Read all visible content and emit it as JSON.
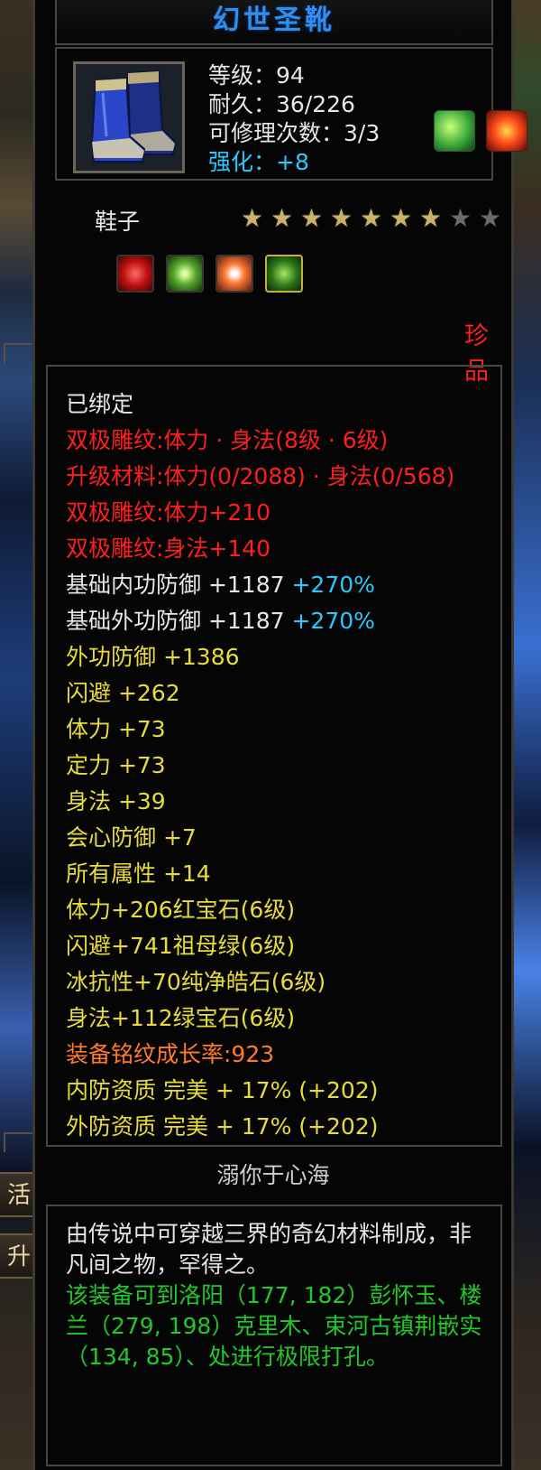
{
  "item": {
    "name": "幻世圣靴",
    "level_label": "等级：94",
    "durability_label": "耐久：36/226",
    "repair_label": "可修理次数：3/3",
    "enhance_prefix": "强化：",
    "enhance_value": "+8",
    "type": "鞋子",
    "rarity": "珍品",
    "stars": {
      "filled": 7,
      "total": 9
    },
    "gems": [
      "red-ruby-gem",
      "green-jade-gem",
      "white-diamond-gem",
      "emerald-gem"
    ],
    "skill_icons": [
      "green-leaf-skill-icon",
      "fire-skill-icon"
    ]
  },
  "attributes": [
    {
      "text": "已绑定",
      "color": "white"
    },
    {
      "text": "双极雕纹:体力 · 身法(8级 · 6级)",
      "color": "red"
    },
    {
      "text": "升级材料:体力(0/2088) · 身法(0/568)",
      "color": "red"
    },
    {
      "text": "双极雕纹:体力+210",
      "color": "red"
    },
    {
      "text": "双极雕纹:身法+140",
      "color": "red"
    },
    {
      "text": "基础内功防御 +1187",
      "color": "white",
      "extra": " +270%"
    },
    {
      "text": "基础外功防御 +1187",
      "color": "white",
      "extra": " +270%"
    },
    {
      "text": "外功防御 +1386",
      "color": "yellow"
    },
    {
      "text": "闪避 +262",
      "color": "yellow"
    },
    {
      "text": "体力 +73",
      "color": "yellow"
    },
    {
      "text": "定力 +73",
      "color": "yellow"
    },
    {
      "text": "身法 +39",
      "color": "yellow"
    },
    {
      "text": "会心防御 +7",
      "color": "yellow"
    },
    {
      "text": "所有属性 +14",
      "color": "yellow"
    },
    {
      "text": "体力+206红宝石(6级)",
      "color": "yellow"
    },
    {
      "text": "闪避+741祖母绿(6级)",
      "color": "yellow"
    },
    {
      "text": "冰抗性+70纯净皓石(6级)",
      "color": "yellow"
    },
    {
      "text": "身法+112绿宝石(6级)",
      "color": "yellow"
    },
    {
      "text": "装备铭纹成长率:923",
      "color": "orange"
    },
    {
      "text": "内防资质 完美 + 17% (+202)",
      "color": "yellow"
    },
    {
      "text": "外防资质 完美 + 17% (+202)",
      "color": "yellow"
    }
  ],
  "subtitle": "溺你于心海",
  "description": {
    "line1": "由传说中可穿越三界的奇幻材料制成，非凡间之物，罕得之。",
    "line2": "该装备可到洛阳（177, 182）彭怀玉、楼兰（279, 198）克里木、束河古镇荆嵌实（134, 85）、处进行极限打孔。"
  },
  "side_buttons": [
    "活",
    "升"
  ],
  "colors": {
    "title": "#2e8ff0",
    "red": "#ff1e1e",
    "yellow": "#e8dc3a",
    "orange": "#ff7a2a",
    "cyan": "#29c8ff",
    "green": "#22c82a"
  }
}
